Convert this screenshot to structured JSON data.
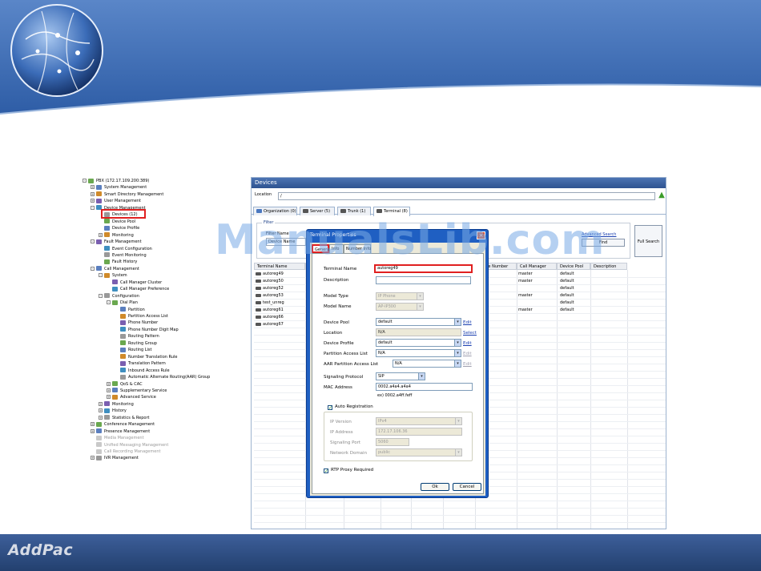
{
  "slide": {
    "footer_logo": "AddPac",
    "watermark": "ManualsLib.com"
  },
  "tree": {
    "rows": [
      {
        "label": "PBX (172.17.109.200:389)",
        "level": 0,
        "exp": "-"
      },
      {
        "label": "System Management",
        "level": 1,
        "exp": "+"
      },
      {
        "label": "Smart Directory Management",
        "level": 1,
        "exp": "+"
      },
      {
        "label": "User Management",
        "level": 1,
        "exp": "+"
      },
      {
        "label": "Device Management",
        "level": 1,
        "exp": "-"
      },
      {
        "label": "Devices (12)",
        "level": 2,
        "exp": ""
      },
      {
        "label": "Device Pool",
        "level": 2,
        "exp": ""
      },
      {
        "label": "Device Profile",
        "level": 2,
        "exp": ""
      },
      {
        "label": "Monitoring",
        "level": 2,
        "exp": "+"
      },
      {
        "label": "Fault Management",
        "level": 1,
        "exp": "-"
      },
      {
        "label": "Event Configuration",
        "level": 2,
        "exp": ""
      },
      {
        "label": "Event Monitoring",
        "level": 2,
        "exp": ""
      },
      {
        "label": "Fault History",
        "level": 2,
        "exp": ""
      },
      {
        "label": "Call Management",
        "level": 1,
        "exp": "-"
      },
      {
        "label": "System",
        "level": 2,
        "exp": "-"
      },
      {
        "label": "Call Manager Cluster",
        "level": 3,
        "exp": ""
      },
      {
        "label": "Call Manager Preference",
        "level": 3,
        "exp": ""
      },
      {
        "label": "Configuration",
        "level": 2,
        "exp": "-"
      },
      {
        "label": "Dial Plan",
        "level": 3,
        "exp": "-"
      },
      {
        "label": "Partition",
        "level": 4,
        "exp": ""
      },
      {
        "label": "Partition Access List",
        "level": 4,
        "exp": ""
      },
      {
        "label": "Phone Number",
        "level": 4,
        "exp": ""
      },
      {
        "label": "Phone Number Digit Map",
        "level": 4,
        "exp": ""
      },
      {
        "label": "Routing Pattern",
        "level": 4,
        "exp": ""
      },
      {
        "label": "Routing Group",
        "level": 4,
        "exp": ""
      },
      {
        "label": "Routing List",
        "level": 4,
        "exp": ""
      },
      {
        "label": "Number Translation Rule",
        "level": 4,
        "exp": ""
      },
      {
        "label": "Translation Pattern",
        "level": 4,
        "exp": ""
      },
      {
        "label": "Inbound Access Rule",
        "level": 4,
        "exp": ""
      },
      {
        "label": "Automatic Alternate Routing(AAR) Group",
        "level": 4,
        "exp": ""
      },
      {
        "label": "QoS & CAC",
        "level": 3,
        "exp": "+"
      },
      {
        "label": "Supplementary Service",
        "level": 3,
        "exp": "+"
      },
      {
        "label": "Advanced Service",
        "level": 3,
        "exp": "+"
      },
      {
        "label": "Monitoring",
        "level": 2,
        "exp": "+"
      },
      {
        "label": "History",
        "level": 2,
        "exp": "+"
      },
      {
        "label": "Statistics & Report",
        "level": 2,
        "exp": "+"
      },
      {
        "label": "Conference Management",
        "level": 1,
        "exp": "+"
      },
      {
        "label": "Presence Management",
        "level": 1,
        "exp": "+"
      },
      {
        "label": "Media Management",
        "level": 1,
        "exp": "",
        "dim": true
      },
      {
        "label": "Unified Messaging Management",
        "level": 1,
        "exp": "",
        "dim": true
      },
      {
        "label": "Call Recording Management",
        "level": 1,
        "exp": "",
        "dim": true
      },
      {
        "label": "IVR Management",
        "level": 1,
        "exp": "+"
      }
    ]
  },
  "panel": {
    "title": "Devices",
    "location_label": "Location",
    "location_value": "/",
    "tabs": [
      "Organization (0)",
      "Server (5)",
      "Trunk (1)",
      "Terminal (8)"
    ],
    "filter": {
      "legend": "Filter",
      "name_label": "Filter Name",
      "name_value": "Device Name",
      "advanced": "Advanced Search",
      "find": "Find",
      "full_search": "Full Search"
    },
    "columns": [
      "Terminal Name",
      "",
      "",
      "",
      "",
      "",
      "Phone Number",
      "Call Manager",
      "Device Pool",
      "Description"
    ],
    "rows": [
      {
        "name": "autoreg49",
        "cm": "master",
        "pool": "default"
      },
      {
        "name": "autoreg50",
        "cm": "master",
        "pool": "default"
      },
      {
        "name": "autoreg52",
        "cm": "",
        "pool": "default"
      },
      {
        "name": "autoreg53",
        "cm": "master",
        "pool": "default"
      },
      {
        "name": "test_unreg",
        "cm": "",
        "pool": "default"
      },
      {
        "name": "autoreg61",
        "cm": "master",
        "pool": "default"
      },
      {
        "name": "autoreg66",
        "cm": "",
        "pool": ""
      },
      {
        "name": "autoreg67",
        "cm": "",
        "pool": ""
      }
    ]
  },
  "dialog": {
    "title": "Terminal Properties",
    "close": "×",
    "tabs": [
      "General",
      "Info",
      "Number Info"
    ],
    "fields": {
      "terminal_name_label": "Terminal Name",
      "terminal_name": "autoreg49",
      "description_label": "Description",
      "description": "",
      "model_type_label": "Model Type",
      "model_type": "IP Phone",
      "model_name_label": "Model Name",
      "model_name": "AP-IP300",
      "device_pool_label": "Device Pool",
      "device_pool": "default",
      "location_label": "Location",
      "location": "N/A",
      "device_profile_label": "Device Profile",
      "device_profile": "default",
      "partition_acl_label": "Partition Access List",
      "partition_acl": "N/A",
      "aar_acl_label": "AAR Partition Access List",
      "aar_acl": "N/A",
      "signaling_protocol_label": "Signaling Protocol",
      "signaling_protocol": "SIP",
      "mac_label": "MAC Address",
      "mac": "0002.a4a4.a4a4",
      "mac_hint": "ex) 0002.a4ff.feff",
      "auto_reg_label": "Auto Registration",
      "ip_version_label": "IP Version",
      "ip_version": "IPv4",
      "ip_address_label": "IP Address",
      "ip_address": "172.17.106.36",
      "signaling_port_label": "Signaling Port",
      "signaling_port": "5060",
      "network_domain_label": "Network Domain",
      "network_domain": "public",
      "rtp_label": "RTP Proxy Required"
    },
    "links": {
      "edit": "Edit",
      "select": "Select"
    },
    "ok": "Ok",
    "cancel": "Cancel"
  },
  "colors": {
    "header_blue": "#2f5fa8",
    "highlight_red": "#e02020",
    "dialog_blue": "#1f5fc2"
  }
}
